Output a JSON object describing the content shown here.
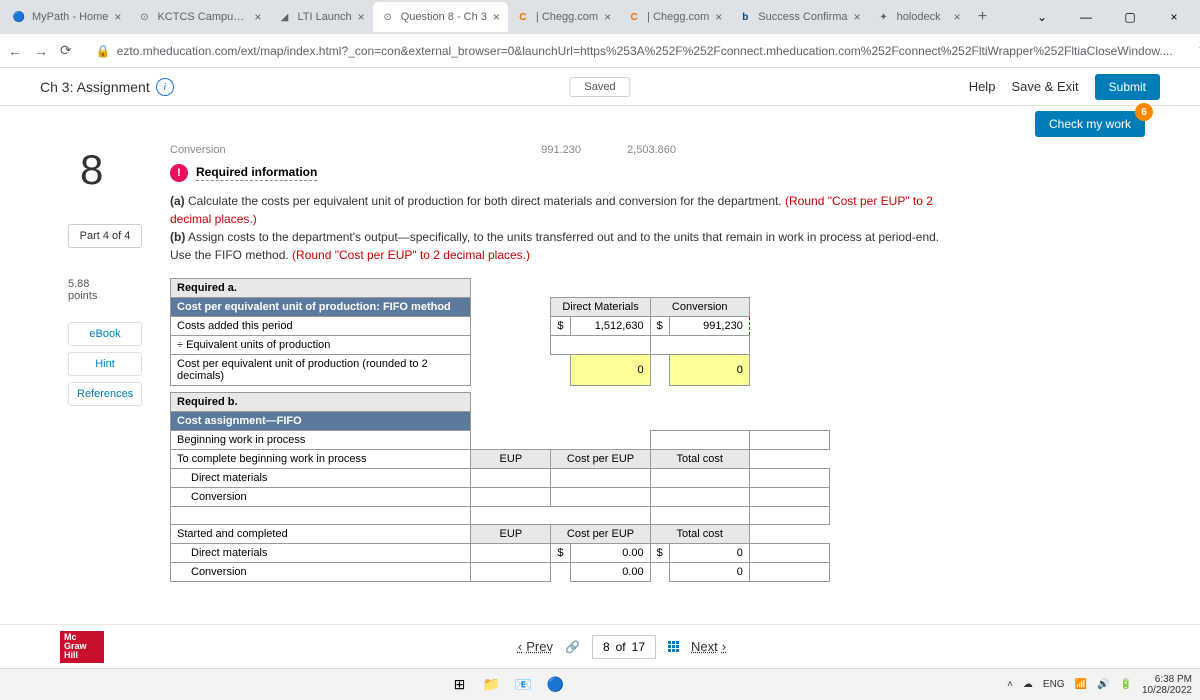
{
  "tabs": [
    {
      "title": "MyPath - Home",
      "icon": "🏠"
    },
    {
      "title": "KCTCS Campus So",
      "icon": "⊙"
    },
    {
      "title": "LTI Launch",
      "icon": "◢"
    },
    {
      "title": "Question 8 - Ch 3",
      "icon": "⊙",
      "active": true
    },
    {
      "title": "| Chegg.com",
      "icon": "C"
    },
    {
      "title": "| Chegg.com",
      "icon": "C"
    },
    {
      "title": "Success Confirma",
      "icon": "b"
    },
    {
      "title": "holodeck",
      "icon": "✦"
    }
  ],
  "url": "ezto.mheducation.com/ext/map/index.html?_con=con&external_browser=0&launchUrl=https%253A%252F%252Fconnect.mheducation.com%252Fconnect%252FltiWrapper%252FltiaCloseWindow....",
  "assignment": {
    "title": "Ch 3: Assignment",
    "saved": "Saved",
    "help": "Help",
    "save_exit": "Save & Exit",
    "submit": "Submit",
    "check": "Check my work",
    "check_count": "6"
  },
  "question": {
    "num": "8",
    "part": "Part 4 of 4",
    "points_val": "5.88",
    "points_lbl": "points"
  },
  "sidelinks": {
    "ebook": "eBook",
    "hint": "Hint",
    "refs": "References"
  },
  "faded": {
    "label": "Conversion",
    "v1": "991.230",
    "v2": "2,503.860"
  },
  "req_info": "Required information",
  "instr": {
    "a_pre": "(a)",
    "a_txt": " Calculate the costs per equivalent unit of production for both direct materials and conversion for the department. ",
    "a_red": "(Round \"Cost per EUP\" to 2 decimal places.)",
    "b_pre": "(b)",
    "b_txt": " Assign costs to the department's output—specifically, to the units transferred out and to the units that remain in work in process at period-end. Use the FIFO method. ",
    "b_red": "(Round \"Cost per EUP\" to 2 decimal places.)"
  },
  "table": {
    "req_a": "Required a.",
    "fifo_hdr": "Cost per equivalent unit of production: FIFO method",
    "dm": "Direct Materials",
    "conv": "Conversion",
    "costs_added": "Costs added this period",
    "costs_dm": "1,512,630",
    "costs_conv": "991,230",
    "equiv": "÷ Equivalent units of production",
    "cpu": "Cost per equivalent unit of production (rounded to 2 decimals)",
    "cpu_dm": "0",
    "cpu_conv": "0",
    "req_b": "Required b.",
    "cost_assign": "Cost assignment—FIFO",
    "beg": "Beginning work in process",
    "complete_beg": "To complete beginning work in process",
    "eup": "EUP",
    "cpe": "Cost per EUP",
    "total": "Total cost",
    "dm_row": "Direct materials",
    "conv_row": "Conversion",
    "started": "Started and completed",
    "sc_dm_cpe": "0.00",
    "sc_dm_tot": "0",
    "sc_conv_cpe": "0.00",
    "sc_conv_tot": "0",
    "dollar": "$"
  },
  "pager": {
    "prev": "Prev",
    "next": "Next",
    "cur": "8",
    "of": "of",
    "tot": "17"
  },
  "logo": {
    "l1": "Mc",
    "l2": "Graw",
    "l3": "Hill"
  },
  "sys": {
    "lang": "ENG",
    "time": "6:38 PM",
    "date": "10/28/2022"
  }
}
